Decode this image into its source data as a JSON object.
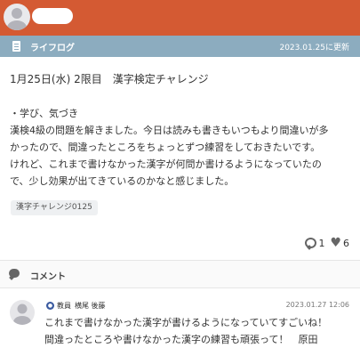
{
  "header": {
    "section_title": "ライフログ",
    "updated": "2023.01.25に更新"
  },
  "post": {
    "title": "1月25日(水) 2限目　漢字検定チャレンジ",
    "body_lines": [
      "・学び、気づき",
      "漢検4級の問題を解きました。今日は読みも書きもいつもより間違いが多",
      "かったので、間違ったところをちょっとずつ練習をしておきたいです。",
      "けれど、これまで書けなかった漢字が何問か書けるようになっていたの",
      "で、少し効果が出てきているのかなと感じました。"
    ],
    "tag": "漢字チャレンジ0125",
    "comment_count": "1",
    "like_count": "6"
  },
  "comments_section": {
    "label": "コメント"
  },
  "comment": {
    "role": "教員",
    "author": "横尾 後藤",
    "date": "2023.01.27 12:06",
    "lines": [
      "これまで書けなかった漢字が書けるようになっていてすごいね！",
      "間違ったところや書けなかった漢字の練習も頑張って！　原田"
    ]
  },
  "colors": {
    "topbar": "#d45a33",
    "headerbar": "#8cacbf",
    "badge": "#3a5aa0"
  }
}
